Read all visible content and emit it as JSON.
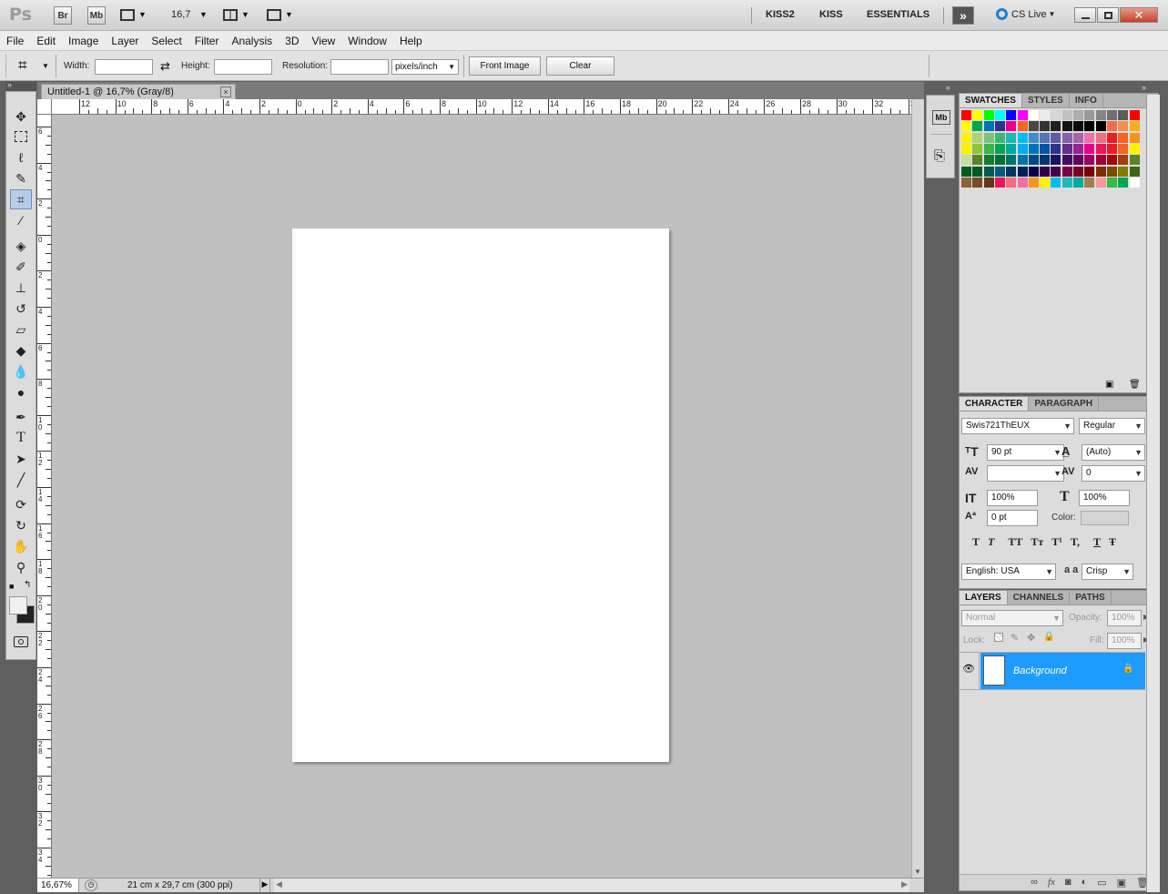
{
  "appbar": {
    "logo": "Ps",
    "br": "Br",
    "mb": "Mb",
    "zoom_value": "16,7",
    "workspaces": [
      "KISS2",
      "KISS",
      "ESSENTIALS"
    ],
    "cs_live": "CS Live"
  },
  "menu": [
    "File",
    "Edit",
    "Image",
    "Layer",
    "Select",
    "Filter",
    "Analysis",
    "3D",
    "View",
    "Window",
    "Help"
  ],
  "options": {
    "width_label": "Width:",
    "height_label": "Height:",
    "resolution_label": "Resolution:",
    "width_value": "",
    "height_value": "",
    "resolution_value": "",
    "unit": "pixels/inch",
    "front_image": "Front Image",
    "clear": "Clear"
  },
  "document": {
    "tab_title": "Untitled-1 @ 16,7% (Gray/8)",
    "close": "×",
    "ruler_h": [
      "12",
      "10",
      "8",
      "6",
      "4",
      "2",
      "0",
      "2",
      "4",
      "6",
      "8",
      "10",
      "12",
      "14",
      "16",
      "18",
      "20",
      "22",
      "24",
      "26",
      "28",
      "30",
      "32",
      "34"
    ],
    "ruler_v": [
      "6",
      "4",
      "2",
      "0",
      "2",
      "4",
      "6",
      "8",
      "1 0",
      "1 2",
      "1 4",
      "1 6",
      "1 8",
      "2 0",
      "2 2",
      "2 4",
      "2 6",
      "2 8",
      "3 0",
      "3 2",
      "3 4"
    ]
  },
  "status": {
    "zoom": "16,67%",
    "doc_size": "21 cm x 29,7 cm (300 ppi)"
  },
  "swatches_panel": {
    "tabs": [
      "SWATCHES",
      "STYLES",
      "INFO"
    ],
    "colors": [
      "#ff0000",
      "#ffff00",
      "#00ff00",
      "#00ffff",
      "#0000ff",
      "#ff00ff",
      "#ffffff",
      "#ebebeb",
      "#d6d6d6",
      "#c2c2c2",
      "#adadad",
      "#999999",
      "#858585",
      "#707070",
      "#5c5c5c",
      "#ff0000",
      "#ffff00",
      "#00a651",
      "#0072bc",
      "#2e3192",
      "#ec008c",
      "#f26522",
      "#474747",
      "#333333",
      "#1f1f1f",
      "#141414",
      "#0a0a0a",
      "#000000",
      "#000000",
      "#f26c4f",
      "#f68e55",
      "#fbad1d",
      "#fff200",
      "#acd373",
      "#7cc576",
      "#3bb878",
      "#1abbb4",
      "#00bff3",
      "#438ccb",
      "#5574b9",
      "#605ca8",
      "#855fa8",
      "#a763a8",
      "#f06eaa",
      "#f26d7d",
      "#ed1c24",
      "#f26522",
      "#f7941d",
      "#fff200",
      "#8dc63f",
      "#39b54a",
      "#00a651",
      "#00a99d",
      "#00aeef",
      "#0072bc",
      "#0054a6",
      "#2e3192",
      "#662d91",
      "#92278f",
      "#ec008c",
      "#ed145b",
      "#ed1c24",
      "#f26522",
      "#fff200",
      "#c4df9b",
      "#598527",
      "#197b30",
      "#007236",
      "#00746b",
      "#0076a3",
      "#004a80",
      "#003471",
      "#1b1464",
      "#440e62",
      "#630460",
      "#9e005d",
      "#9e0039",
      "#9e0b0f",
      "#a0410d",
      "#598527",
      "#005e20",
      "#005826",
      "#005952",
      "#005b7f",
      "#003663",
      "#002157",
      "#0d004c",
      "#32004b",
      "#4b0049",
      "#7b0046",
      "#7a0026",
      "#790000",
      "#7b2e00",
      "#7d4900",
      "#827b00",
      "#406618",
      "#8c6239",
      "#754c24",
      "#603913",
      "#ed145b",
      "#f26d7d",
      "#f06eaa",
      "#f7941d",
      "#fff200",
      "#00bff3",
      "#1abbb4",
      "#00a99d",
      "#a67c52",
      "#f5989d",
      "#39b54a",
      "#00a651",
      "#ffffff"
    ]
  },
  "character_panel": {
    "tabs": [
      "CHARACTER",
      "PARAGRAPH"
    ],
    "font_family": "Swis721ThEUX",
    "font_style": "Regular",
    "size": "90 pt",
    "leading": "(Auto)",
    "kerning": "",
    "tracking": "0",
    "vscale": "100%",
    "hscale": "100%",
    "baseline": "0 pt",
    "color_label": "Color:",
    "language": "English: USA",
    "aa_label": "a a",
    "antialias": "Crisp",
    "type_buttons": [
      "T",
      "T",
      "TT",
      "Tт",
      "T¹",
      "T,",
      "T",
      "Ŧ"
    ]
  },
  "layers_panel": {
    "tabs": [
      "LAYERS",
      "CHANNELS",
      "PATHS"
    ],
    "blend": "Normal",
    "opacity_label": "Opacity:",
    "opacity": "100%",
    "lock_label": "Lock:",
    "fill_label": "Fill:",
    "fill": "100%",
    "layers": [
      {
        "name": "Background"
      }
    ],
    "footer_icons": [
      "link-icon",
      "fx-icon",
      "mask-icon",
      "adjustment-icon",
      "group-icon",
      "new-layer-icon",
      "trash-icon"
    ]
  },
  "colors": {
    "selection": "#1e9bff",
    "canvas_bg": "#c0c0c0"
  }
}
